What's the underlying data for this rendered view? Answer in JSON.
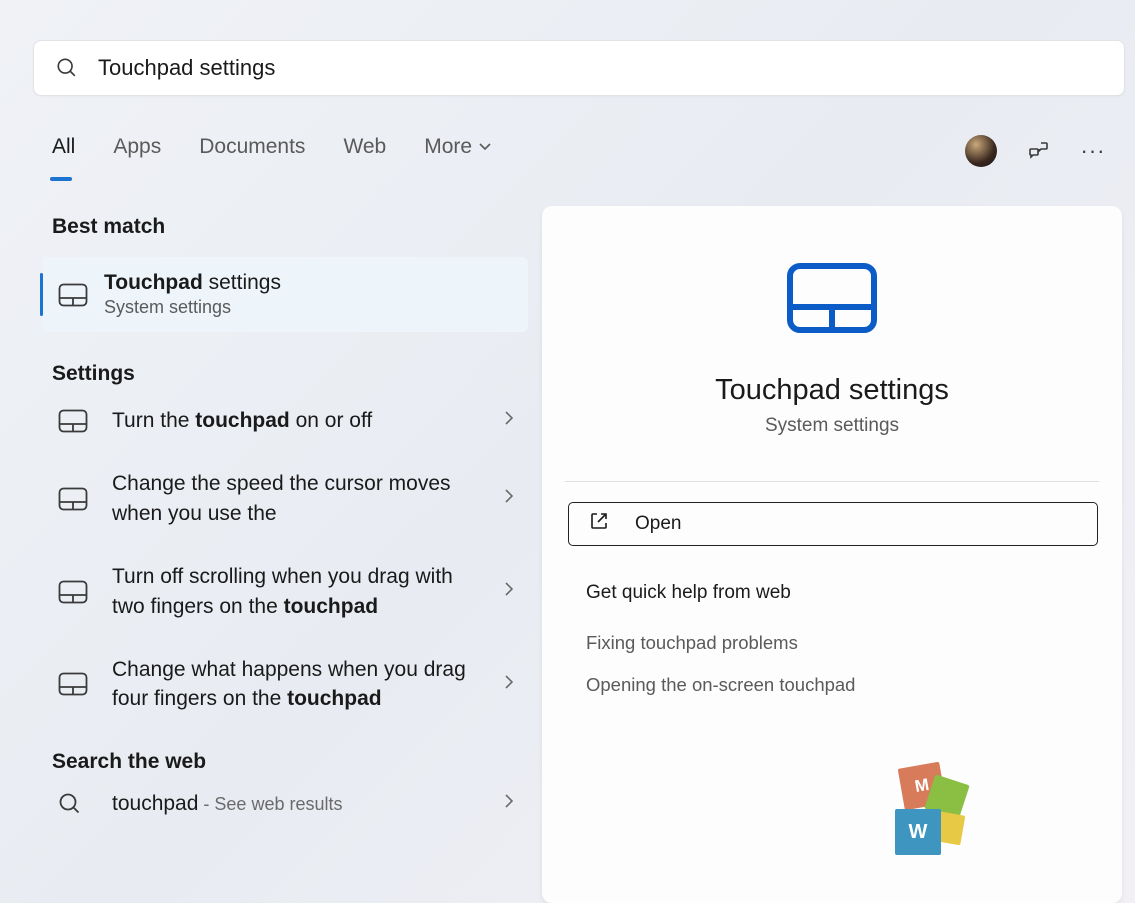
{
  "search": {
    "query": "Touchpad settings"
  },
  "tabs": {
    "all": "All",
    "apps": "Apps",
    "documents": "Documents",
    "web": "Web",
    "more": "More"
  },
  "bestMatch": {
    "header": "Best match",
    "title_prefix": "Touchpad ",
    "title_rest": "settings",
    "subtitle": "System settings"
  },
  "settings": {
    "header": "Settings",
    "items": [
      {
        "pre": "Turn the ",
        "bold": "touchpad",
        "post": " on or off"
      },
      {
        "pre": "Change the speed the cursor moves when you use the",
        "bold": "",
        "post": ""
      },
      {
        "pre": "Turn off scrolling when you drag with two fingers on the ",
        "bold": "touchpad",
        "post": ""
      },
      {
        "pre": "Change what happens when you drag four fingers on the ",
        "bold": "touchpad",
        "post": ""
      }
    ]
  },
  "webSearch": {
    "header": "Search the web",
    "term": "touchpad",
    "suffix": " - See web results"
  },
  "preview": {
    "title": "Touchpad settings",
    "subtitle": "System settings",
    "open_label": "Open",
    "help_header": "Get quick help from web",
    "help_links": [
      "Fixing touchpad problems",
      "Opening the on-screen touchpad"
    ]
  }
}
